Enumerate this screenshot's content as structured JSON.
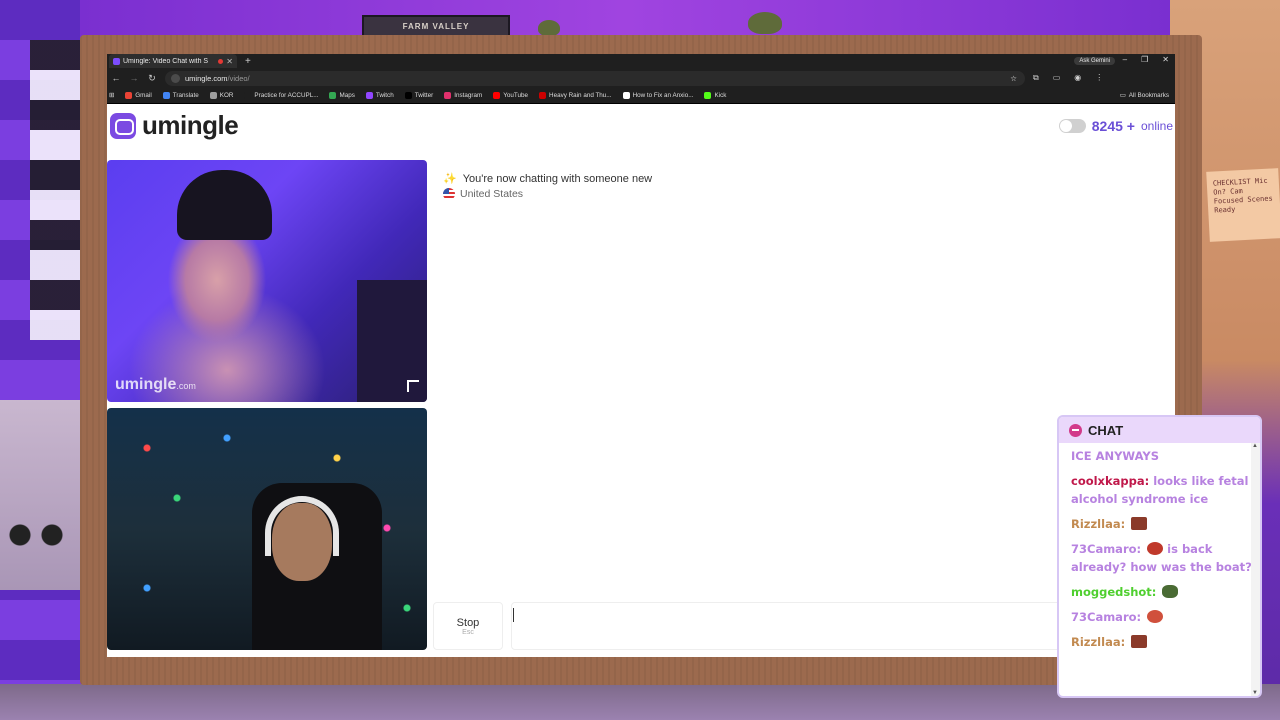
{
  "backdrop": {
    "sign_text": "FARM VALLEY",
    "note_text": "CHECKLIST Mic On? Cam Focused Scenes Ready"
  },
  "browser": {
    "tab_title": "Umingle: Video Chat with S",
    "new_tab": "+",
    "ask_gemini": "Ask Gemini",
    "url_host": "umingle.com",
    "url_path": "/video/",
    "all_bookmarks": "All Bookmarks",
    "bookmarks": [
      {
        "label": "Gmail",
        "color": "#ea4335"
      },
      {
        "label": "Translate",
        "color": "#4285f4"
      },
      {
        "label": "KOR",
        "color": "#9e9e9e"
      },
      {
        "label": "Practice for ACCUPL...",
        "color": "#1f1f1f"
      },
      {
        "label": "Maps",
        "color": "#34a853"
      },
      {
        "label": "Twitch",
        "color": "#9146ff"
      },
      {
        "label": "Twitter",
        "color": "#000000"
      },
      {
        "label": "Instagram",
        "color": "#e1306c"
      },
      {
        "label": "YouTube",
        "color": "#ff0000"
      },
      {
        "label": "Heavy Rain and Thu...",
        "color": "#cc0000"
      },
      {
        "label": "How to Fix an Anxio...",
        "color": "#ffffff"
      },
      {
        "label": "Kick",
        "color": "#53fc18"
      }
    ]
  },
  "site": {
    "brand": "umingle",
    "online_count": "8245 +",
    "online_label": "online",
    "watermark": "umingle",
    "watermark_suffix": ".com",
    "status_message": "You're now chatting with someone new",
    "country": "United States",
    "stop_label": "Stop",
    "stop_hint": "Esc"
  },
  "stream_chat": {
    "title": "CHAT",
    "messages": [
      {
        "user": "",
        "text": "ICE ANYWAYS"
      },
      {
        "user": "coolxkappa:",
        "text": "looks like fetal alcohol syndrome ice"
      },
      {
        "user": "Rizzllaa:",
        "text": ""
      },
      {
        "user": "73Camaro:",
        "text": "is back already? how was the boat?"
      },
      {
        "user": "moggedshot:",
        "text": ""
      },
      {
        "user": "73Camaro:",
        "text": ""
      },
      {
        "user": "Rizzllaa:",
        "text": ""
      }
    ]
  }
}
